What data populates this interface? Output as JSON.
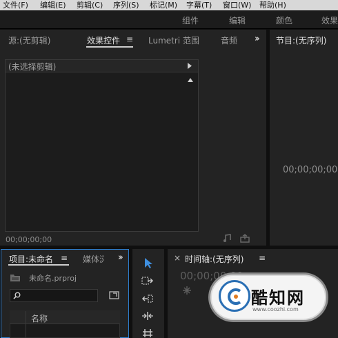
{
  "menu": [
    "文件(F)",
    "编辑(E)",
    "剪辑(C)",
    "序列(S)",
    "标记(M)",
    "字幕(T)",
    "窗口(W)",
    "帮助(H)"
  ],
  "workspaces": [
    "组件",
    "编辑",
    "颜色",
    "效果"
  ],
  "source_panel": {
    "tabs": [
      "源:(无剪辑)",
      "效果控件",
      "Lumetri 范围",
      "音频"
    ],
    "active_tab_index": 1,
    "no_clip_text": "(未选择剪辑)",
    "timecode": "00;00;00;00"
  },
  "program_panel": {
    "title": "节目:(无序列)",
    "timecode": "00;00;00;00"
  },
  "project_panel": {
    "tabs": [
      "项目:未命名",
      "媒体浏"
    ],
    "file": "未命名.prproj",
    "search_placeholder": "",
    "column_name": "名称"
  },
  "timeline_panel": {
    "title": "时间轴:(无序列)",
    "close": "×",
    "timecode": "00;00;00;00"
  },
  "watermark": {
    "brand": "酷知网",
    "url": "www.coozhi.com"
  }
}
